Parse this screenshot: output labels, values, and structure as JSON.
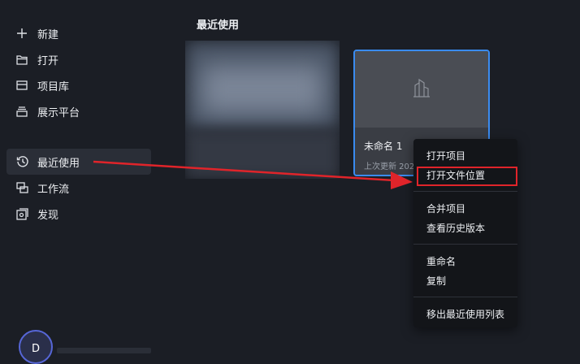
{
  "sidebar": {
    "items": [
      {
        "label": "新建",
        "icon": "plus-icon"
      },
      {
        "label": "打开",
        "icon": "folder-icon"
      },
      {
        "label": "项目库",
        "icon": "library-icon"
      },
      {
        "label": "展示平台",
        "icon": "showcase-icon"
      },
      {
        "label": "最近使用",
        "icon": "history-icon",
        "active": true
      },
      {
        "label": "工作流",
        "icon": "workflow-icon"
      },
      {
        "label": "发现",
        "icon": "discover-icon"
      }
    ],
    "avatar_letter": "D"
  },
  "main": {
    "section_title": "最近使用",
    "card": {
      "title": "未命名 1",
      "subtitle": "上次更新 202"
    }
  },
  "context_menu": {
    "groups": [
      [
        "打开项目",
        "打开文件位置"
      ],
      [
        "合并项目",
        "查看历史版本"
      ],
      [
        "重命名",
        "复制"
      ],
      [
        "移出最近使用列表"
      ]
    ],
    "highlighted": "打开文件位置"
  },
  "annotation": {
    "arrow_color": "#e0242a",
    "box_color": "#e0242a"
  },
  "colors": {
    "accent": "#3a8bf0",
    "background": "#1b1e25"
  }
}
